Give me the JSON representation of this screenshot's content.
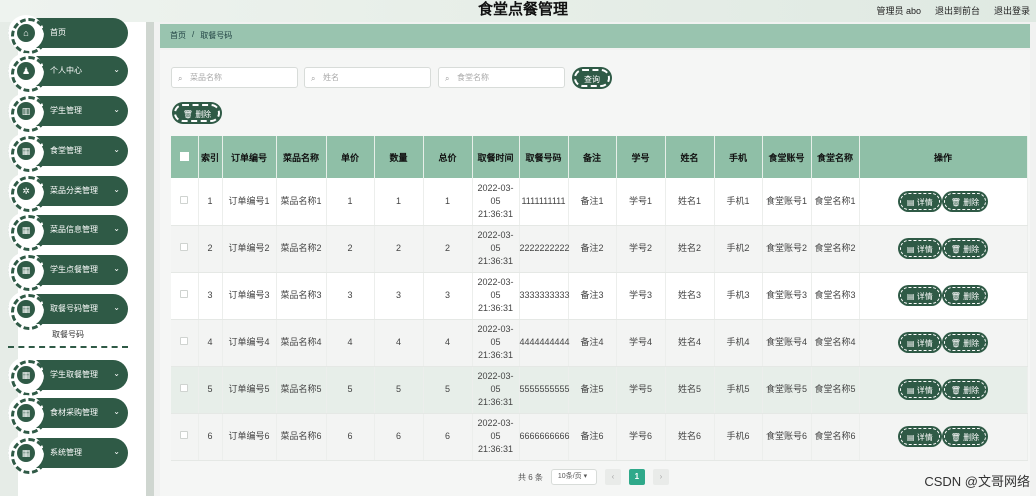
{
  "header": {
    "title": "食堂点餐管理",
    "admin": "管理员 abo",
    "back_front": "退出到前台",
    "logout": "退出登录"
  },
  "sidebar": {
    "items": [
      {
        "label": "首页",
        "icon": "home-icon",
        "glyph": "⌂",
        "chevron": false
      },
      {
        "label": "个人中心",
        "icon": "user-icon",
        "glyph": "♟",
        "chevron": true
      },
      {
        "label": "学生管理",
        "icon": "chart-icon",
        "glyph": "▥",
        "chevron": true
      },
      {
        "label": "食堂管理",
        "icon": "grid-icon",
        "glyph": "▦",
        "chevron": true
      },
      {
        "label": "菜品分类管理",
        "icon": "gear-icon",
        "glyph": "✲",
        "chevron": true
      },
      {
        "label": "菜品信息管理",
        "icon": "grid-icon",
        "glyph": "▦",
        "chevron": true
      },
      {
        "label": "学生点餐管理",
        "icon": "grid-icon",
        "glyph": "▦",
        "chevron": true
      },
      {
        "label": "取餐号码管理",
        "icon": "grid-icon",
        "glyph": "▦",
        "chevron": true
      },
      {
        "label": "学生取餐管理",
        "icon": "grid-icon",
        "glyph": "▦",
        "chevron": true
      },
      {
        "label": "食材采购管理",
        "icon": "grid-icon",
        "glyph": "▦",
        "chevron": true
      },
      {
        "label": "系统管理",
        "icon": "grid-icon",
        "glyph": "▦",
        "chevron": true
      }
    ],
    "submenu_label": "取餐号码"
  },
  "breadcrumb": {
    "home": "首页",
    "sep": "/",
    "current": "取餐号码"
  },
  "search": {
    "dish_placeholder": "菜品名称",
    "name_placeholder": "姓名",
    "canteen_placeholder": "食堂名称",
    "query_label": "查询",
    "delete_label": "删除"
  },
  "table": {
    "headers": [
      "索引",
      "订单编号",
      "菜品名称",
      "单价",
      "数量",
      "总价",
      "取餐时间",
      "取餐号码",
      "备注",
      "学号",
      "姓名",
      "手机",
      "食堂账号",
      "食堂名称",
      "操作"
    ],
    "detail_label": "详情",
    "delete_label": "删除",
    "rows": [
      {
        "idx": "1",
        "order": "订单编号1",
        "dish": "菜品名称1",
        "price": "1",
        "qty": "1",
        "total": "1",
        "time": "2022-03-05 21:36:31",
        "code": "1111111111",
        "note": "备注1",
        "sno": "学号1",
        "name": "姓名1",
        "phone": "手机1",
        "acct": "食堂账号1",
        "canteen": "食堂名称1"
      },
      {
        "idx": "2",
        "order": "订单编号2",
        "dish": "菜品名称2",
        "price": "2",
        "qty": "2",
        "total": "2",
        "time": "2022-03-05 21:36:31",
        "code": "2222222222",
        "note": "备注2",
        "sno": "学号2",
        "name": "姓名2",
        "phone": "手机2",
        "acct": "食堂账号2",
        "canteen": "食堂名称2"
      },
      {
        "idx": "3",
        "order": "订单编号3",
        "dish": "菜品名称3",
        "price": "3",
        "qty": "3",
        "total": "3",
        "time": "2022-03-05 21:36:31",
        "code": "3333333333",
        "note": "备注3",
        "sno": "学号3",
        "name": "姓名3",
        "phone": "手机3",
        "acct": "食堂账号3",
        "canteen": "食堂名称3"
      },
      {
        "idx": "4",
        "order": "订单编号4",
        "dish": "菜品名称4",
        "price": "4",
        "qty": "4",
        "total": "4",
        "time": "2022-03-05 21:36:31",
        "code": "4444444444",
        "note": "备注4",
        "sno": "学号4",
        "name": "姓名4",
        "phone": "手机4",
        "acct": "食堂账号4",
        "canteen": "食堂名称4"
      },
      {
        "idx": "5",
        "order": "订单编号5",
        "dish": "菜品名称5",
        "price": "5",
        "qty": "5",
        "total": "5",
        "time": "2022-03-05 21:36:31",
        "code": "5555555555",
        "note": "备注5",
        "sno": "学号5",
        "name": "姓名5",
        "phone": "手机5",
        "acct": "食堂账号5",
        "canteen": "食堂名称5"
      },
      {
        "idx": "6",
        "order": "订单编号6",
        "dish": "菜品名称6",
        "price": "6",
        "qty": "6",
        "total": "6",
        "time": "2022-03-05 21:36:31",
        "code": "6666666666",
        "note": "备注6",
        "sno": "学号6",
        "name": "姓名6",
        "phone": "手机6",
        "acct": "食堂账号6",
        "canteen": "食堂名称6"
      }
    ]
  },
  "pagination": {
    "total": "共 6 条",
    "page_size": "10条/页",
    "prev": "‹",
    "current": "1",
    "next": "›"
  },
  "watermark": "CSDN @文哥网络",
  "colors": {
    "brand": "#2f5a46",
    "header_row": "#8fbfa7",
    "active_page": "#2fa98a"
  }
}
